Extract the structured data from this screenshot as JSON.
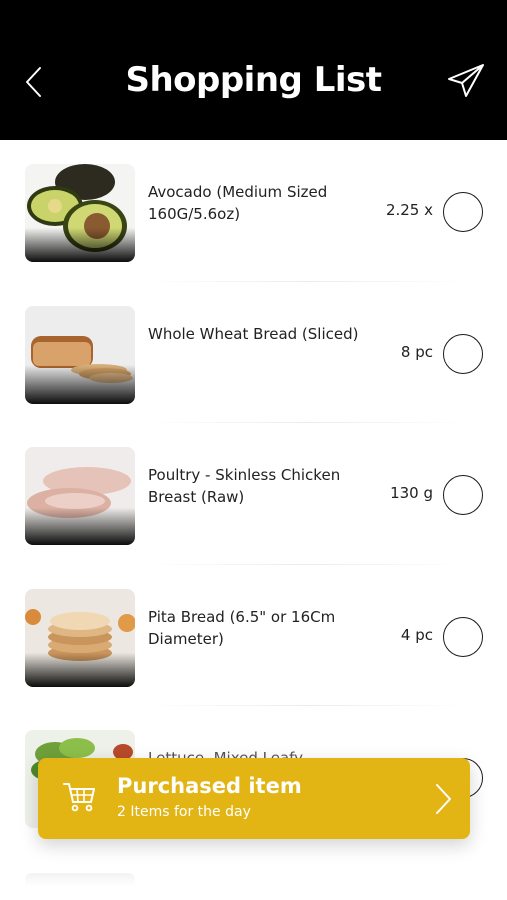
{
  "header": {
    "title": "Shopping List",
    "back_icon": "chevron-left-icon",
    "share_icon": "paper-plane-icon",
    "background": "#000000"
  },
  "items": [
    {
      "name": "Avocado (Medium Sized 160G/5.6oz)",
      "qty": "2.25 x",
      "image": "avocado",
      "checked": false
    },
    {
      "name": "Whole Wheat Bread (Sliced)",
      "qty": "8 pc",
      "image": "bread",
      "checked": false
    },
    {
      "name": "Poultry - Skinless Chicken Breast (Raw)",
      "qty": "130 g",
      "image": "chicken",
      "checked": false
    },
    {
      "name": "Pita Bread (6.5\" or 16Cm Diameter)",
      "qty": "4 pc",
      "image": "pita",
      "checked": false
    },
    {
      "name": "Lettuce, Mixed Leafy",
      "qty": "",
      "image": "lettuce",
      "checked": false
    }
  ],
  "purchased": {
    "title": "Purchased item",
    "subtitle": "2 Items for the day",
    "icon": "cart-icon",
    "accent": "#e2b514"
  }
}
